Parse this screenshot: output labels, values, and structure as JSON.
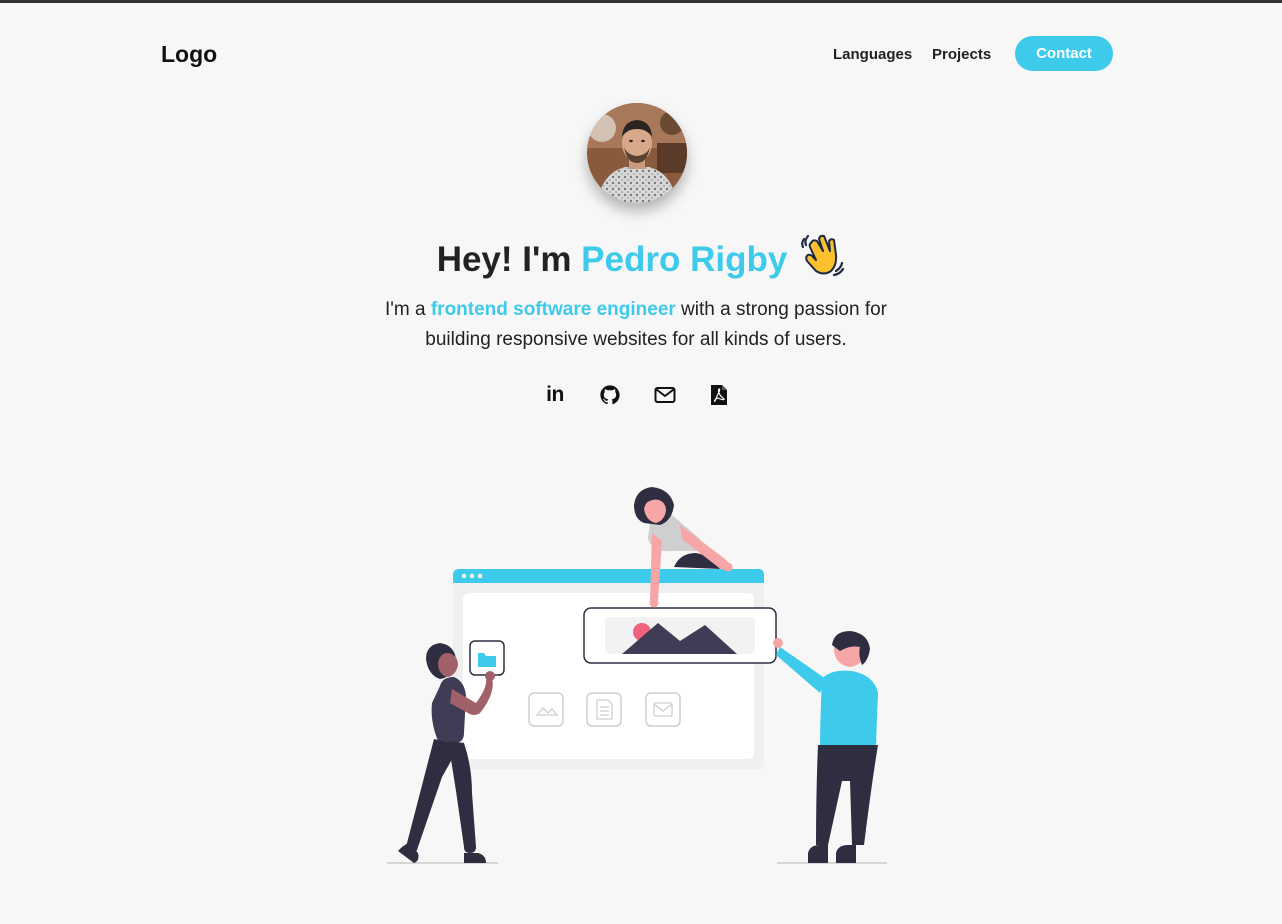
{
  "nav": {
    "logo": "Logo",
    "links": [
      "Languages",
      "Projects"
    ],
    "contact_label": "Contact"
  },
  "hero": {
    "greeting": "Hey! I'm ",
    "name": "Pedro Rigby",
    "wave_icon": "waving-hand-icon",
    "intro_prefix": "I'm a ",
    "intro_highlight": "frontend software engineer",
    "intro_suffix": " with a strong passion for building responsive websites for all kinds of users."
  },
  "socials": [
    {
      "icon": "linkedin-icon",
      "label": "in"
    },
    {
      "icon": "github-icon"
    },
    {
      "icon": "mail-icon"
    },
    {
      "icon": "pdf-icon"
    }
  ],
  "colors": {
    "accent": "#3ecbeb",
    "background": "#f7f7f7",
    "text": "#222222",
    "figure_dark": "#2f2e41",
    "figure_pink": "#f6a6a6"
  }
}
